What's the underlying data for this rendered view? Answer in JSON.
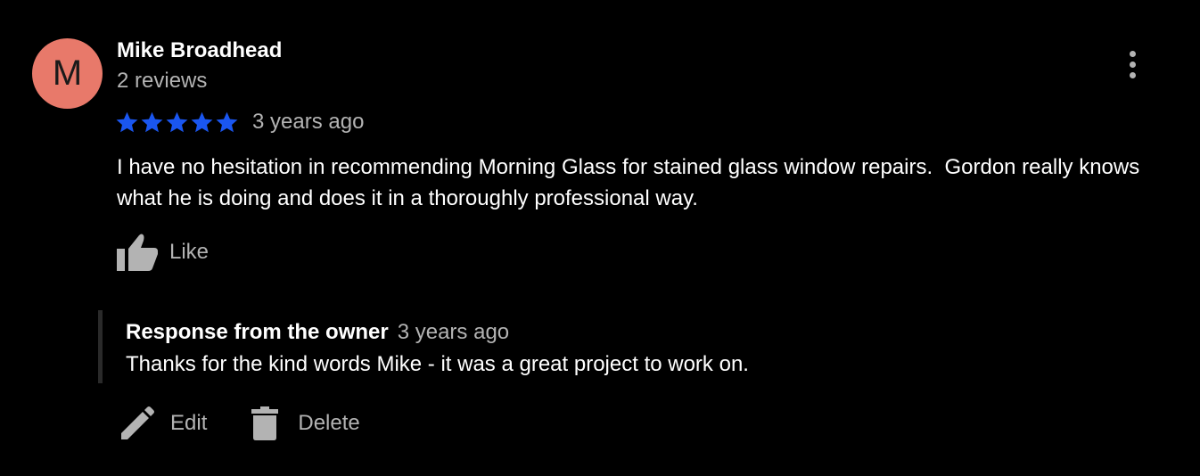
{
  "review": {
    "author": {
      "initial": "M",
      "name": "Mike Broadhead",
      "review_count": "2 reviews",
      "avatar_color": "#e8796a"
    },
    "menu_icon": "more-vertical-icon",
    "rating": {
      "stars": 5,
      "max": 5,
      "star_color": "#1a56f0",
      "star_icon": "star-icon"
    },
    "date": "3 years ago",
    "text": "I have no hesitation in recommending Morning Glass for stained glass window repairs.  Gordon really knows what he is doing and does it in a thoroughly professional way.",
    "like": {
      "icon": "thumbs-up-icon",
      "label": "Like"
    }
  },
  "owner_response": {
    "title": "Response from the owner",
    "date": "3 years ago",
    "text": "Thanks for the kind words Mike - it was a great project to work on."
  },
  "actions": {
    "edit": {
      "icon": "pencil-icon",
      "label": "Edit"
    },
    "delete": {
      "icon": "trash-icon",
      "label": "Delete"
    }
  }
}
